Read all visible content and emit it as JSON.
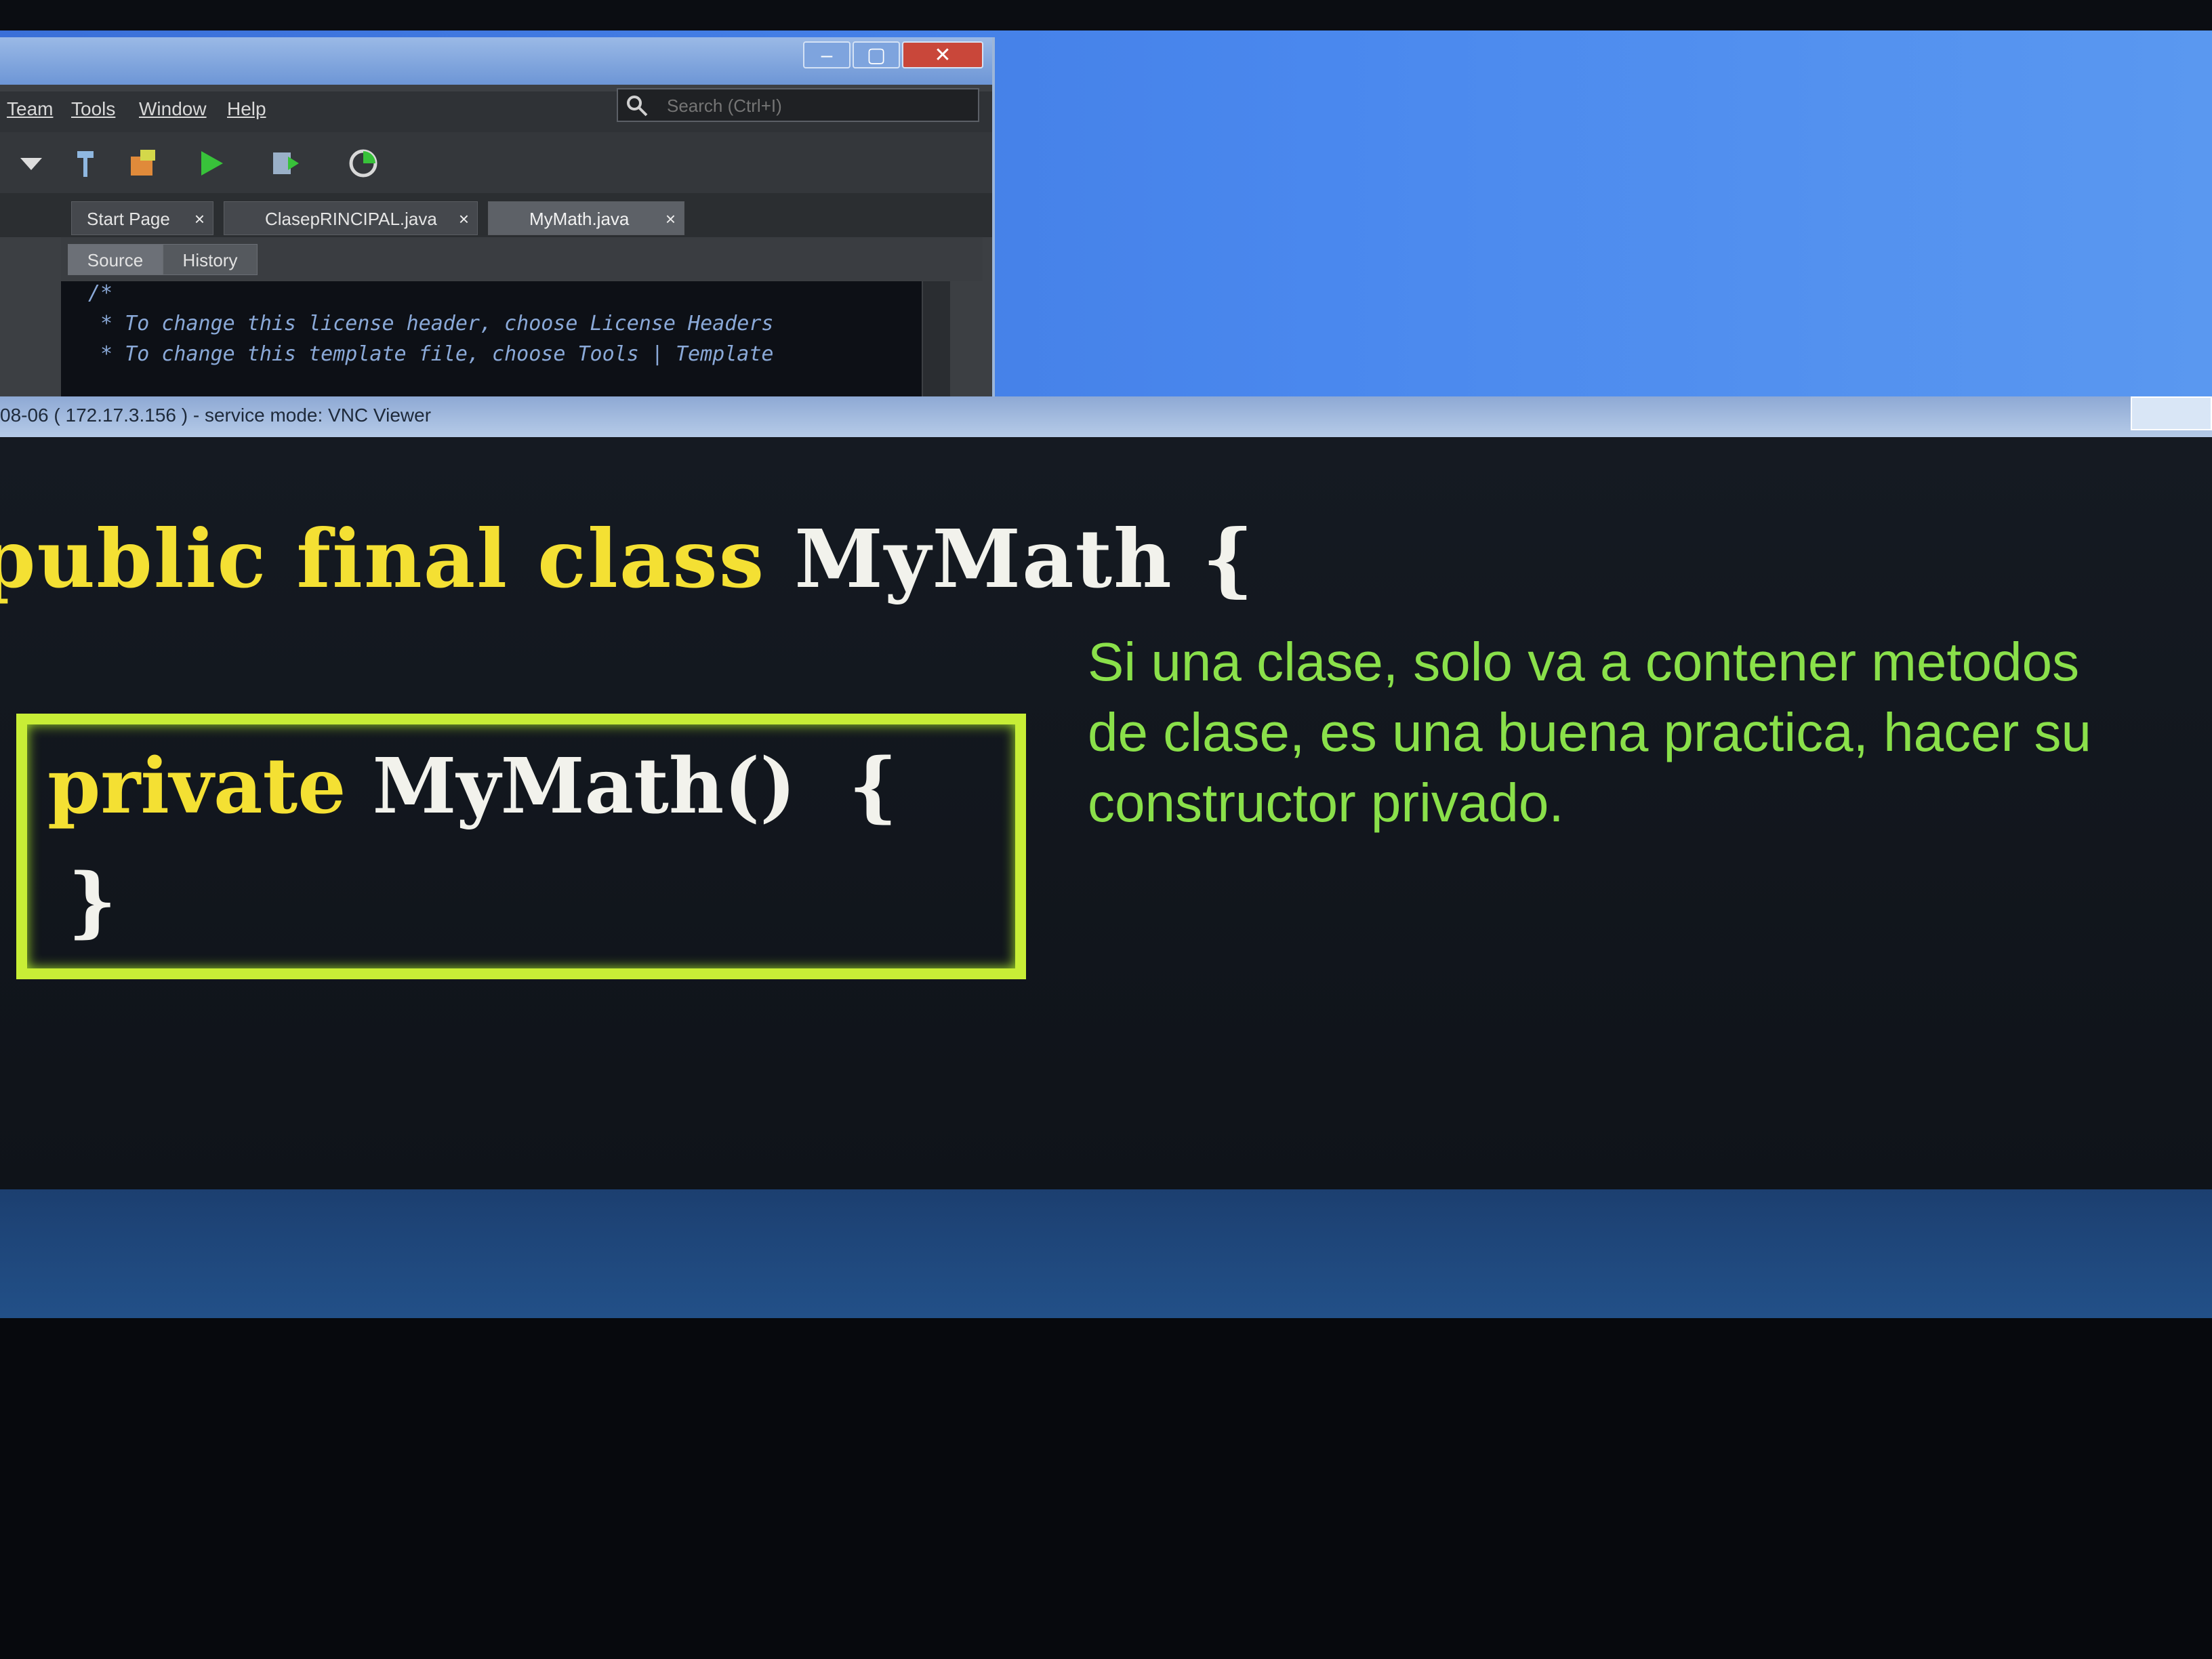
{
  "ide": {
    "window_controls": {
      "minimize": "–",
      "maximize": "▢",
      "close": "✕"
    },
    "menu": [
      "Team",
      "Tools",
      "Window",
      "Help"
    ],
    "search_placeholder": "Search (Ctrl+I)",
    "tabs": [
      {
        "label": "Start Page",
        "close": "×"
      },
      {
        "label": "ClasepRINCIPAL.java",
        "close": "×"
      },
      {
        "label": "MyMath.java",
        "close": "×",
        "active": true
      }
    ],
    "editor_tabs": [
      "Source",
      "History"
    ],
    "code_lines": [
      "/*",
      " * To change this license header, choose License Headers",
      " * To change this template file, choose Tools | Template"
    ]
  },
  "vnc": {
    "title": "08-06 ( 172.17.3.156 ) - service mode: VNC Viewer"
  },
  "slide": {
    "class_decl": {
      "kw1": "public",
      "kw2": "final",
      "kw3": "class",
      "name": "MyMath",
      "brace": "{"
    },
    "ctor": {
      "kw": "private",
      "name": "MyMath()",
      "brace": "{",
      "close": "}"
    },
    "note": "Si una clase, solo va a contener metodos de clase, es una buena practica, hacer su constructor privado."
  },
  "colors": {
    "keyword": "#f4e033",
    "identifier": "#f2f2ec",
    "note": "#8ae04a",
    "box": "#c8ee36"
  }
}
